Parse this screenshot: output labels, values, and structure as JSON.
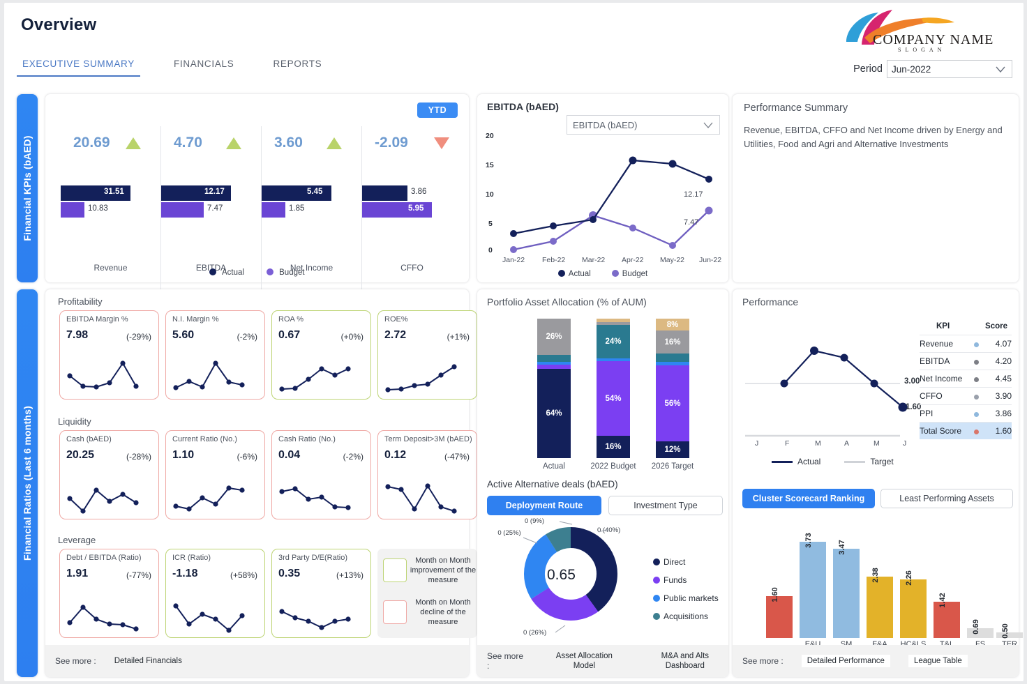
{
  "header": {
    "title": "Overview",
    "tabs": [
      {
        "label": "EXECUTIVE SUMMARY",
        "active": true
      },
      {
        "label": "FINANCIALS",
        "active": false
      },
      {
        "label": "REPORTS",
        "active": false
      }
    ],
    "logo_text": "COMPANY NAME",
    "logo_slogan": "SLOGAN",
    "period_label": "Period",
    "period_value": "Jun-2022"
  },
  "rails": {
    "kpi": "Financial KPIs (bAED)",
    "ratios": "Financial Ratios (Last 6 months)"
  },
  "kpi_card": {
    "ytd_badge": "YTD",
    "legend": [
      {
        "label": "Actual",
        "color": "#13205a"
      },
      {
        "label": "Budget",
        "color": "#6a45d4"
      }
    ],
    "items": [
      {
        "name": "Revenue",
        "value": "20.69",
        "trend": "up",
        "actual": "31.51",
        "budget": "10.83",
        "actual_pct": 100,
        "budget_pct": 34
      },
      {
        "name": "EBITDA",
        "value": "4.70",
        "trend": "up",
        "actual": "12.17",
        "budget": "7.47",
        "actual_pct": 100,
        "budget_pct": 61
      },
      {
        "name": "Net Income",
        "value": "3.60",
        "trend": "up",
        "actual": "5.45",
        "budget": "1.85",
        "actual_pct": 100,
        "budget_pct": 34
      },
      {
        "name": "CFFO",
        "value": "-2.09",
        "trend": "down",
        "actual": "3.86",
        "budget": "5.95",
        "actual_pct": 65,
        "budget_pct": 100
      }
    ]
  },
  "chart_data": [
    {
      "id": "ebitda_line",
      "type": "line",
      "title": "EBITDA (bAED)",
      "selector_value": "EBITDA (bAED)",
      "x": [
        "Jan-22",
        "Feb-22",
        "Mar-22",
        "Apr-22",
        "May-22",
        "Jun-22"
      ],
      "series": [
        {
          "name": "Actual",
          "color": "#13205a",
          "values": [
            3.0,
            4.3,
            5.4,
            15.3,
            14.6,
            12.17
          ],
          "end_label": "12.17"
        },
        {
          "name": "Budget",
          "color": "#6f5fc0",
          "values": [
            0.4,
            1.7,
            6.3,
            4.0,
            1.4,
            7.47
          ],
          "end_label": "7.47"
        }
      ],
      "yticks": [
        "0",
        "5",
        "10",
        "15",
        "20"
      ],
      "ylim": [
        0,
        20
      ],
      "grid": false,
      "legend_position": "bottom"
    },
    {
      "id": "asset_allocation",
      "type": "bar",
      "title": "Portfolio Asset Allocation (% of AUM)",
      "categories": [
        "Actual",
        "2022 Budget",
        "2026 Target"
      ],
      "stacked": true,
      "series": [
        {
          "name": "s1",
          "color": "#13205a",
          "values": [
            64,
            16,
            12
          ],
          "labels": [
            "64%",
            "16%",
            "12%"
          ]
        },
        {
          "name": "s2",
          "color": "#7b3ff2",
          "values": [
            3,
            54,
            56
          ],
          "labels": [
            "",
            "54%",
            "56%"
          ]
        },
        {
          "name": "s3",
          "color": "#2f86f2",
          "values": [
            2,
            2,
            2
          ],
          "labels": [
            "",
            "",
            ""
          ]
        },
        {
          "name": "s4",
          "color": "#2a7a90",
          "values": [
            5,
            24,
            6
          ],
          "labels": [
            "",
            "24%",
            ""
          ]
        },
        {
          "name": "s5",
          "color": "#9a9a9e",
          "values": [
            26,
            2,
            16
          ],
          "labels": [
            "26%",
            "",
            "16%"
          ]
        },
        {
          "name": "s6",
          "color": "#dcb982",
          "values": [
            0,
            2,
            8
          ],
          "labels": [
            "",
            "",
            "8%"
          ]
        }
      ],
      "ylim": [
        0,
        100
      ]
    },
    {
      "id": "alt_deals_donut",
      "type": "pie",
      "title": "Active Alternative deals (bAED)",
      "center_value": "0.65",
      "labels": [
        "Direct",
        "Funds",
        "Public markets",
        "Acquisitions"
      ],
      "values": [
        40,
        26,
        25,
        9
      ],
      "value_labels": [
        "0 (40%)",
        "0 (26%)",
        "0 (25%)",
        "0 (9%)"
      ],
      "colors": [
        "#13205a",
        "#7b3ff2",
        "#2f86f2",
        "#3d7f90"
      ],
      "legend_position": "right"
    },
    {
      "id": "performance_line",
      "type": "line",
      "title": "Performance",
      "x": [
        "J",
        "F",
        "M",
        "A",
        "M",
        "J"
      ],
      "series": [
        {
          "name": "Actual",
          "color": "#13205a",
          "values": [
            null,
            3.0,
            4.5,
            4.3,
            3.1,
            1.6
          ]
        },
        {
          "name": "Target",
          "color": "#cfd2d7",
          "values": [
            3.0,
            3.0,
            3.0,
            3.0,
            3.0,
            3.0
          ]
        }
      ],
      "annotations": [
        "3.00",
        "1.60"
      ],
      "ylim": [
        0,
        5
      ]
    },
    {
      "id": "cluster_scorecard",
      "type": "bar",
      "title": "Cluster Scorecard Ranking",
      "categories": [
        "",
        "E&U",
        "SM",
        "F&A",
        "HC&LS",
        "T&L",
        "FS",
        "TER"
      ],
      "values": [
        1.6,
        3.73,
        3.47,
        2.38,
        2.26,
        1.42,
        0.69,
        0.5
      ],
      "value_labels": [
        "1.60",
        "3.73",
        "3.47",
        "2.38",
        "2.26",
        "1.42",
        "0.69",
        "0.50"
      ],
      "colors": [
        "#d9574a",
        "#90bbe0",
        "#90bbe0",
        "#e3b229",
        "#e3b229",
        "#d9574a",
        "#dddddd",
        "#dddddd"
      ],
      "ylim": [
        0,
        4
      ]
    }
  ],
  "performance_summary": {
    "title": "Performance Summary",
    "body": "Revenue, EBITDA, CFFO and Net Income driven by Energy and Utilities, Food and Agri and Alternative Investments"
  },
  "ratios": {
    "sections": [
      {
        "name": "Profitability",
        "tiles": [
          {
            "title": "EBITDA Margin %",
            "value": "7.98",
            "delta": "(-29%)",
            "state": "bad",
            "spark": [
              52,
              30,
              26,
              25,
              33,
              75,
              18
            ]
          },
          {
            "title": "N.I. Margin %",
            "value": "5.60",
            "delta": "(-2%)",
            "state": "bad",
            "spark": [
              18,
              28,
              42,
              20,
              78,
              38,
              32
            ]
          },
          {
            "title": "ROA %",
            "value": "0.67",
            "delta": "(+0%)",
            "state": "good",
            "spark": [
              12,
              12,
              14,
              38,
              62,
              48,
              62
            ]
          },
          {
            "title": "ROE%",
            "value": "2.72",
            "delta": "(+1%)",
            "state": "good",
            "spark": [
              10,
              12,
              22,
              24,
              46,
              62,
              72
            ]
          }
        ]
      },
      {
        "name": "Liquidity",
        "tiles": [
          {
            "title": "Cash (bAED)",
            "value": "20.25",
            "delta": "(-28%)",
            "state": "bad",
            "spark": [
              48,
              10,
              68,
              36,
              56,
              48,
              34
            ]
          },
          {
            "title": "Current Ratio (No.)",
            "value": "1.10",
            "delta": "(-6%)",
            "state": "bad",
            "spark": [
              22,
              16,
              48,
              30,
              72,
              68,
              null
            ]
          },
          {
            "title": "Cash Ratio (No.)",
            "value": "0.04",
            "delta": "(-2%)",
            "state": "bad",
            "spark": [
              62,
              68,
              44,
              48,
              24,
              22,
              null
            ]
          },
          {
            "title": "Term Deposit>3M (bAED)",
            "value": "0.12",
            "delta": "(-47%)",
            "state": "bad",
            "spark": [
              74,
              68,
              20,
              76,
              26,
              16,
              null
            ]
          }
        ]
      },
      {
        "name": "Leverage",
        "tiles": [
          {
            "title": "Debt / EBITDA (Ratio)",
            "value": "1.91",
            "delta": "(-77%)",
            "state": "bad",
            "spark": [
              28,
              62,
              34,
              24,
              22,
              14,
              null
            ]
          },
          {
            "title": "ICR (Ratio)",
            "value": "-1.18",
            "delta": "(+58%)",
            "state": "good",
            "spark": [
              64,
              26,
              48,
              38,
              10,
              46,
              null
            ]
          },
          {
            "title": "3rd Party D/E(Ratio)",
            "value": "0.35",
            "delta": "(+13%)",
            "state": "good",
            "spark": [
              56,
              42,
              34,
              20,
              32,
              38,
              null
            ]
          }
        ]
      }
    ],
    "legend": [
      {
        "state": "good",
        "text": "Month on Month improvement of the measure"
      },
      {
        "state": "bad",
        "text": "Month on Month decline of the measure"
      }
    ]
  },
  "alt_deals": {
    "toggles": [
      {
        "label": "Deployment Route",
        "active": true
      },
      {
        "label": "Investment Type",
        "active": false
      }
    ]
  },
  "performance_panel": {
    "toggles": [
      {
        "label": "Cluster Scorecard Ranking",
        "active": true
      },
      {
        "label": "Least Performing Assets",
        "active": false
      }
    ],
    "legend": [
      {
        "label": "Actual",
        "color": "#13205a"
      },
      {
        "label": "Target",
        "color": "#cfd2d7"
      }
    ],
    "table": {
      "headers": [
        "KPI",
        "Score"
      ],
      "rows": [
        {
          "kpi": "Revenue",
          "score": "4.07",
          "dot": "#8fb8dd"
        },
        {
          "kpi": "EBITDA",
          "score": "4.20",
          "dot": "#7d7f86"
        },
        {
          "kpi": "Net Income",
          "score": "4.45",
          "dot": "#7d7f86"
        },
        {
          "kpi": "CFFO",
          "score": "3.90",
          "dot": "#9aa0ab"
        },
        {
          "kpi": "PPI",
          "score": "3.86",
          "dot": "#8fb8dd"
        },
        {
          "kpi": "Total Score",
          "score": "1.60",
          "dot": "#d9766a",
          "highlight": true
        }
      ]
    }
  },
  "footers": {
    "left": {
      "see_more": "See more :",
      "links": [
        "Detailed Financials"
      ]
    },
    "middle": {
      "see_more": "See more :",
      "links": [
        "Asset Allocation Model",
        "M&A and Alts Dashboard"
      ]
    },
    "right": {
      "see_more": "See more :",
      "links": [
        "Detailed Performance",
        "League Table"
      ]
    }
  }
}
